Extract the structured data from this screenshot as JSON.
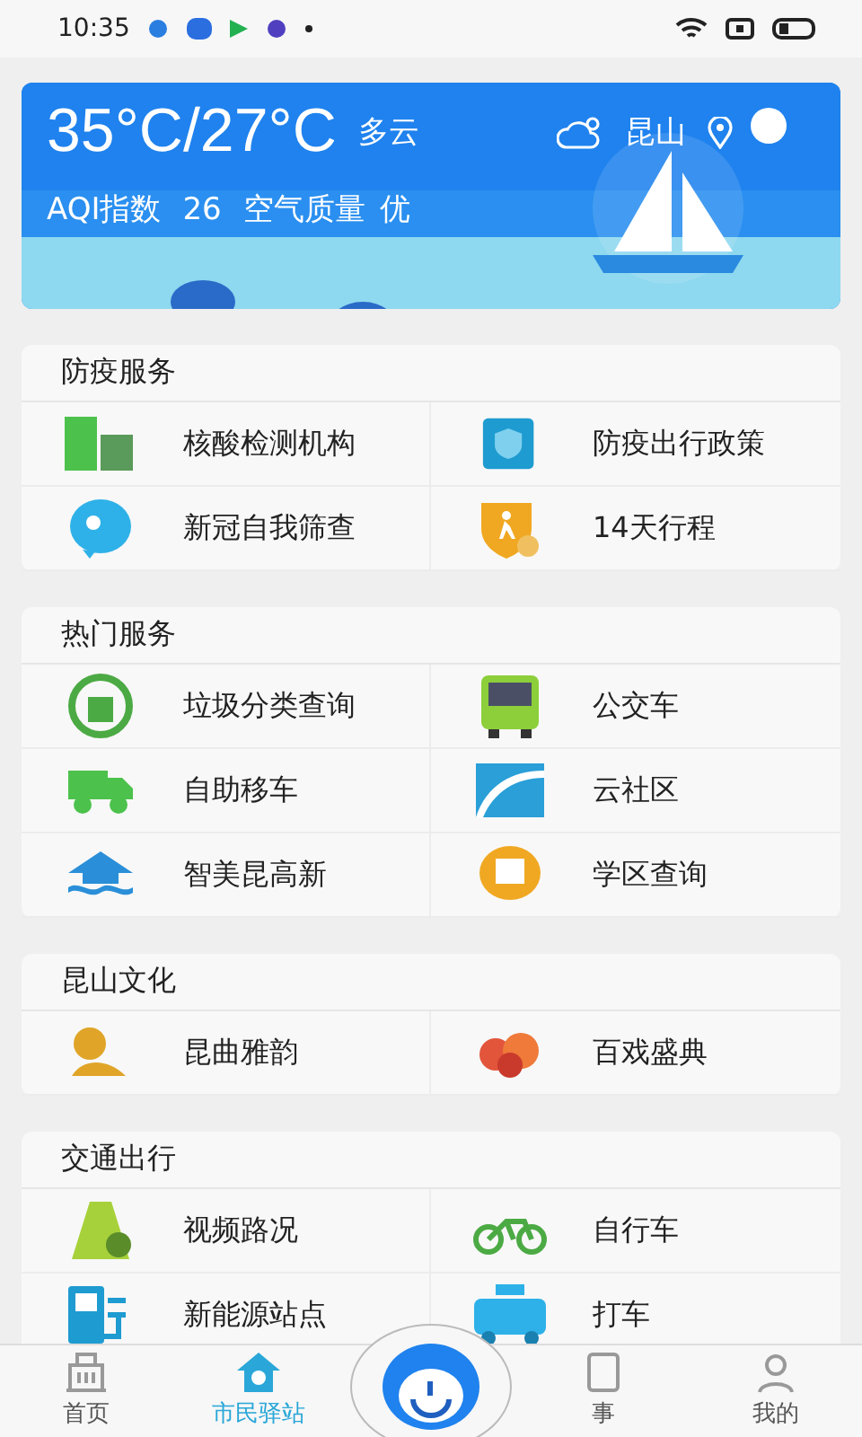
{
  "status_bar": {
    "time": "10:35"
  },
  "weather": {
    "temperature": "35°C/27°C",
    "condition": "多云",
    "city": "昆山",
    "aqi_label": "AQI指数",
    "aqi_value": "26",
    "quality_label": "空气质量",
    "quality_value": "优"
  },
  "sections": [
    {
      "title": "防疫服务",
      "items": [
        "核酸检测机构",
        "防疫出行政策",
        "新冠自我筛查",
        "14天行程"
      ]
    },
    {
      "title": "热门服务",
      "items": [
        "垃圾分类查询",
        "公交车",
        "自助移车",
        "云社区",
        "智美昆高新",
        "学区查询"
      ]
    },
    {
      "title": "昆山文化",
      "items": [
        "昆曲雅韵",
        "百戏盛典"
      ]
    },
    {
      "title": "交通出行",
      "items": [
        "视频路况",
        "自行车",
        "新能源站点",
        "打车"
      ]
    }
  ],
  "tab_bar": [
    {
      "label": "首页",
      "selected": false,
      "kind": "tab"
    },
    {
      "label": "市民驿站",
      "selected": true,
      "kind": "tab"
    },
    {
      "kind": "center"
    },
    {
      "label": "事",
      "selected": false,
      "kind": "tab"
    },
    {
      "label": "我的",
      "selected": false,
      "kind": "tab"
    }
  ]
}
